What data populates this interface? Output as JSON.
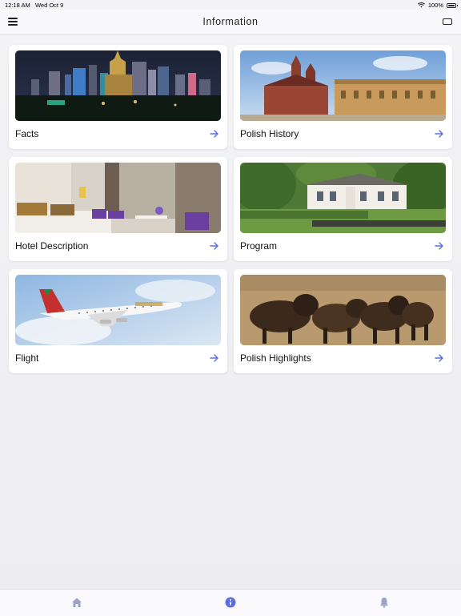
{
  "status_bar": {
    "time": "12:18 AM",
    "date": "Wed Oct 9",
    "battery": "100%",
    "wifi_icon": "wifi-icon",
    "battery_icon": "battery-icon"
  },
  "nav": {
    "title": "Information",
    "menu_icon": "hamburger-menu-icon",
    "right_icon": "device-icon"
  },
  "cards": [
    {
      "label": "Facts",
      "image": "city-skyline-night"
    },
    {
      "label": "Polish History",
      "image": "old-town-church"
    },
    {
      "label": "Hotel Description",
      "image": "hotel-room"
    },
    {
      "label": "Program",
      "image": "manor-house-garden"
    },
    {
      "label": "Flight",
      "image": "airplane-sky"
    },
    {
      "label": "Polish Highlights",
      "image": "bison-herd"
    }
  ],
  "tabs": [
    {
      "icon": "home-icon",
      "active": false
    },
    {
      "icon": "info-icon",
      "active": true
    },
    {
      "icon": "bell-icon",
      "active": false
    }
  ],
  "colors": {
    "accent": "#5b6ee1",
    "tab_inactive": "#9aa3c8",
    "text": "#111111"
  }
}
